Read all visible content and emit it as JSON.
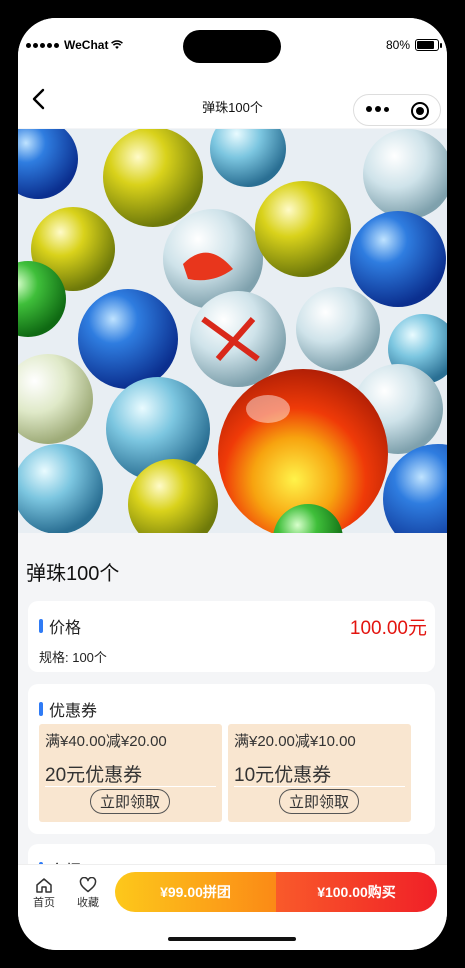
{
  "status_bar": {
    "carrier": "WeChat",
    "battery_text": "80%",
    "battery_level": 0.8
  },
  "nav": {
    "title": "弹珠100个",
    "back_icon": "chevron-left-icon",
    "more_icon": "more-dots-icon",
    "close_icon": "target-icon"
  },
  "product": {
    "image": "colorful glass marbles",
    "title": "弹珠100个"
  },
  "price_section": {
    "heading": "价格",
    "price": "100.00元",
    "spec": "规格: 100个"
  },
  "coupon_section": {
    "heading": "优惠券",
    "coupons": [
      {
        "condition": "满¥40.00减¥20.00",
        "amount": "20元优惠券",
        "button": "立即领取"
      },
      {
        "condition": "满¥20.00减¥10.00",
        "amount": "10元优惠券",
        "button": "立即领取"
      }
    ]
  },
  "intro_section": {
    "heading": "介绍"
  },
  "bottom_bar": {
    "home_label": "首页",
    "favorite_label": "收藏",
    "group_buy_label": "¥99.00拼团",
    "buy_label": "¥100.00购买"
  },
  "colors": {
    "accent_blue": "#2f7bf5",
    "price_red": "#e3140f",
    "coupon_bg": "#f9e6d0",
    "group_buy": "#fdc81b",
    "buy": "#f02027"
  }
}
